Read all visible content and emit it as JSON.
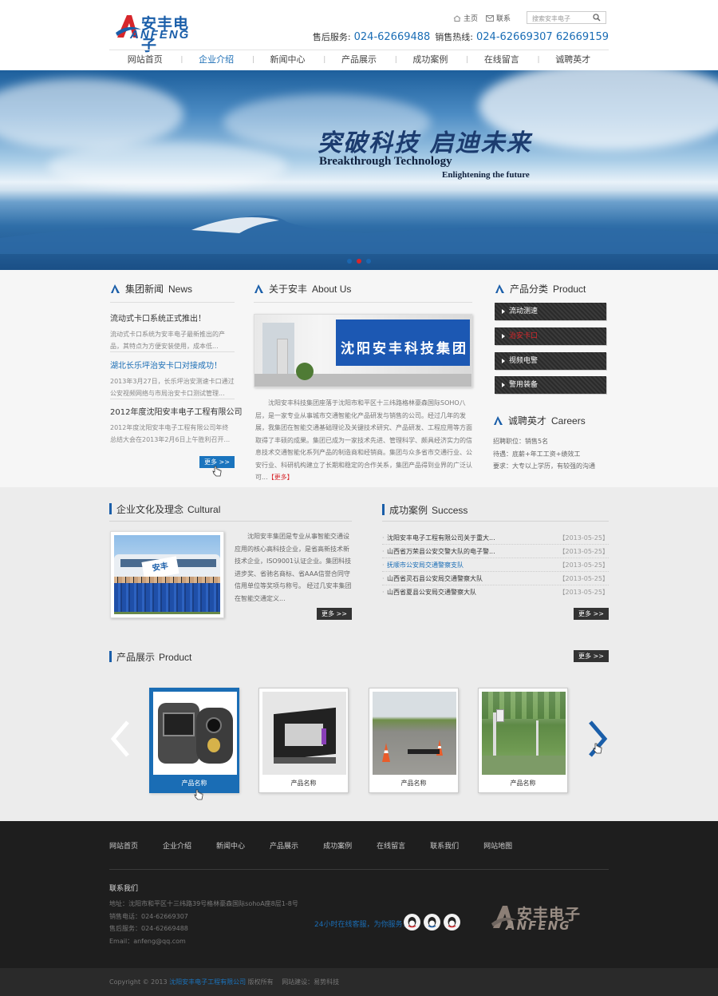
{
  "header": {
    "logo_cn": "安丰电子",
    "logo_en": "ANFENG",
    "top_links": {
      "home": "主页",
      "contact": "联系"
    },
    "search_placeholder": "搜索安丰电子",
    "hotline": {
      "service_label": "售后服务:",
      "service_number": "024-62669488",
      "sales_label": "销售热线:",
      "sales_number": "024-62669307 62669159"
    },
    "nav": [
      "网站首页",
      "企业介绍",
      "新闻中心",
      "产品展示",
      "成功案例",
      "在线留言",
      "诚聘英才"
    ],
    "nav_active": 1
  },
  "banner": {
    "slogan_cn": "突破科技 启迪未来",
    "slogan_en": "Breakthrough Technology",
    "slogan_en2": "Enlightening the future",
    "slides": 3,
    "active_slide": 1
  },
  "news": {
    "title_cn": "集团新闻",
    "title_en": "News",
    "items": [
      {
        "title": "流动式卡口系统正式推出！",
        "summary": "流动式卡口系统为安丰电子最新推出的产品，其特点为方便安装使用，成本低..."
      },
      {
        "title": "湖北长乐坪治安卡口对接成功！",
        "summary": "2013年3月27日，长乐坪治安测速卡口通过公安视频网络与市局治安卡口测试管理..."
      },
      {
        "title": "2012年度沈阳安丰电子工程有限公司",
        "summary": "2012年度沈阳安丰电子工程有限公司年终总结大会在2013年2月6日上午胜利召开..."
      }
    ],
    "more": "更多 >>"
  },
  "about": {
    "title_cn": "关于安丰",
    "title_en": "About Us",
    "wall_text": "沈阳安丰科技集团",
    "text": "沈阳安丰科技集团座落于沈阳市和平区十三纬路格林豪森国际SOHO八层，是一家专业从事城市交通智能化产品研发与销售的公司。经过几年的发展，我集团在智能交通基础理论及关键技术研究、产品研发、工程应用等方面取得了丰硕的成果。集团已成为一家技术先进、管理科学、颇具经济实力的信息技术交通智能化系列产品的制造商和经销商。集团与众多省市交通行业、公安行业、科研机构建立了长期和稳定的合作关系，集团产品得到业界的广泛认可...",
    "more": "【更多】"
  },
  "products_cat": {
    "title_cn": "产品分类",
    "title_en": "Product",
    "items": [
      "流动测速",
      "治安卡口",
      "视频电警",
      "警用装备"
    ],
    "active": 1
  },
  "careers": {
    "title_cn": "诚聘英才",
    "title_en": "Careers",
    "lines": [
      "招聘职位：销售5名",
      "待遇：底薪+年工工资+绩效工",
      "要求：大专以上学历，有较强的沟通"
    ]
  },
  "culture": {
    "title_cn": "企业文化及理念",
    "title_en": "Cultural",
    "banner_text": "安丰",
    "text": "沈阳安丰集团是专业从事智能交通设应用的核心高科技企业，是省高新技术新技术企业，ISO9001认证企业。集团科技进步奖、省驰名商标、省AAA信誉合同守信用单位等奖项与称号。 经过几安丰集团在智能交通定义...",
    "more": "更多 >>"
  },
  "cases": {
    "title_cn": "成功案例",
    "title_en": "Success",
    "items": [
      {
        "title": "沈阳安丰电子工程有限公司关于重大...",
        "date": "【2013-05-25】"
      },
      {
        "title": "山西省万荣县公安交警大队的电子警...",
        "date": "【2013-05-25】"
      },
      {
        "title": "抚顺市公安局交通警察支队",
        "date": "【2013-05-25】"
      },
      {
        "title": "山西省灵石县公安局交通警察大队",
        "date": "【2013-05-25】"
      },
      {
        "title": "山西省夏县公安局交通警察大队",
        "date": "【2013-05-25】"
      }
    ],
    "more": "更多 >>"
  },
  "product_show": {
    "title_cn": "产品展示",
    "title_en": "Product",
    "more": "更多 >>",
    "items": [
      "产品名称",
      "产品名称",
      "产品名称",
      "产品名称"
    ],
    "active": 0
  },
  "footer": {
    "nav": [
      "网站首页",
      "企业介绍",
      "新闻中心",
      "产品展示",
      "成功案例",
      "在线留言",
      "联系我们",
      "网站地图"
    ],
    "contact_title": "联系我们",
    "contact_lines": [
      "地址：沈阳市和平区十三纬路39号格林豪森国际sohoA座8层1-8号",
      "销售电话：024-62669307",
      "售后服务：024-62669488",
      "Email：anfeng@qq.com"
    ],
    "kefu": "24小时在线客服，为你服务！",
    "logo_cn": "安丰电子",
    "logo_en": "ANFENG"
  },
  "copyright": {
    "prefix": "Copyright © 2013",
    "company": "沈阳安丰电子工程有限公司",
    "rights": "版权所有",
    "builder": "网站建设：易势科技"
  },
  "colors": {
    "brand_blue": "#1a6db5",
    "brand_red": "#d7262b",
    "dark": "#1e1e1e"
  }
}
